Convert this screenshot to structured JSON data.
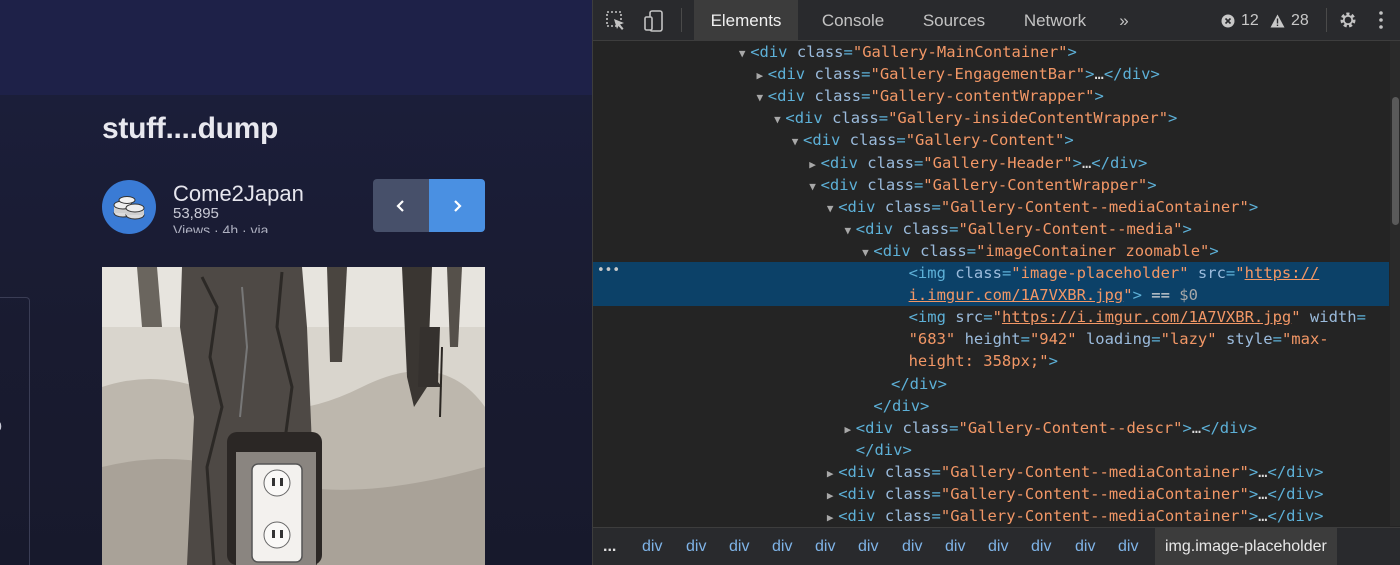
{
  "page": {
    "post_title": "stuff....dump",
    "author_name": "Come2Japan",
    "views": "53,895",
    "meta_line": "Views · 4h · via",
    "side_marks": [
      "-",
      "0",
      "-"
    ]
  },
  "devtools": {
    "tabs": [
      "Elements",
      "Console",
      "Sources",
      "Network",
      "»"
    ],
    "active_tab": "Elements",
    "error_count": "12",
    "warning_count": "28",
    "colors": {
      "selected_row": "#0c4168",
      "tag": "#5db0d7",
      "attr_name": "#9bbbdc",
      "attr_value": "#f29766"
    },
    "dom_lines": [
      {
        "indent": 8,
        "toggle": "open",
        "segments": [
          [
            "tag",
            "<div "
          ],
          [
            "attr",
            "class"
          ],
          [
            "tag",
            "="
          ],
          [
            "val",
            "\"Gallery-MainContainer\""
          ],
          [
            "tag",
            ">"
          ]
        ]
      },
      {
        "indent": 9,
        "toggle": "closed",
        "segments": [
          [
            "tag",
            "<div "
          ],
          [
            "attr",
            "class"
          ],
          [
            "tag",
            "="
          ],
          [
            "val",
            "\"Gallery-EngagementBar\""
          ],
          [
            "tag",
            ">"
          ],
          [
            "plain",
            "…"
          ],
          [
            "tag",
            "</div>"
          ]
        ]
      },
      {
        "indent": 9,
        "toggle": "open",
        "segments": [
          [
            "tag",
            "<div "
          ],
          [
            "attr",
            "class"
          ],
          [
            "tag",
            "="
          ],
          [
            "val",
            "\"Gallery-contentWrapper\""
          ],
          [
            "tag",
            ">"
          ]
        ]
      },
      {
        "indent": 10,
        "toggle": "open",
        "segments": [
          [
            "tag",
            "<div "
          ],
          [
            "attr",
            "class"
          ],
          [
            "tag",
            "="
          ],
          [
            "val",
            "\"Gallery-insideContentWrapper\""
          ],
          [
            "tag",
            ">"
          ]
        ]
      },
      {
        "indent": 11,
        "toggle": "open",
        "segments": [
          [
            "tag",
            "<div "
          ],
          [
            "attr",
            "class"
          ],
          [
            "tag",
            "="
          ],
          [
            "val",
            "\"Gallery-Content\""
          ],
          [
            "tag",
            ">"
          ]
        ]
      },
      {
        "indent": 12,
        "toggle": "closed",
        "segments": [
          [
            "tag",
            "<div "
          ],
          [
            "attr",
            "class"
          ],
          [
            "tag",
            "="
          ],
          [
            "val",
            "\"Gallery-Header\""
          ],
          [
            "tag",
            ">"
          ],
          [
            "plain",
            "…"
          ],
          [
            "tag",
            "</div>"
          ]
        ]
      },
      {
        "indent": 12,
        "toggle": "open",
        "segments": [
          [
            "tag",
            "<div "
          ],
          [
            "attr",
            "class"
          ],
          [
            "tag",
            "="
          ],
          [
            "val",
            "\"Gallery-ContentWrapper\""
          ],
          [
            "tag",
            ">"
          ]
        ]
      },
      {
        "indent": 13,
        "toggle": "open",
        "segments": [
          [
            "tag",
            "<div "
          ],
          [
            "attr",
            "class"
          ],
          [
            "tag",
            "="
          ],
          [
            "val",
            "\"Gallery-Content--mediaContainer\""
          ],
          [
            "tag",
            ">"
          ]
        ]
      },
      {
        "indent": 14,
        "toggle": "open",
        "segments": [
          [
            "tag",
            "<div "
          ],
          [
            "attr",
            "class"
          ],
          [
            "tag",
            "="
          ],
          [
            "val",
            "\"Gallery-Content--media\""
          ],
          [
            "tag",
            ">"
          ]
        ]
      },
      {
        "indent": 15,
        "toggle": "open",
        "segments": [
          [
            "tag",
            "<div "
          ],
          [
            "attr",
            "class"
          ],
          [
            "tag",
            "="
          ],
          [
            "val",
            "\"imageContainer zoomable\""
          ],
          [
            "tag",
            ">"
          ]
        ]
      },
      {
        "indent": 17,
        "toggle": "none",
        "selected": true,
        "segments": [
          [
            "tag",
            "<img "
          ],
          [
            "attr",
            "class"
          ],
          [
            "tag",
            "="
          ],
          [
            "val",
            "\"image-placeholder\""
          ],
          [
            "attr",
            " src"
          ],
          [
            "tag",
            "="
          ],
          [
            "val",
            "\""
          ],
          [
            "link",
            "https://"
          ]
        ]
      },
      {
        "indent": 17,
        "toggle": "none",
        "selected": true,
        "segments": [
          [
            "link",
            "i.imgur.com/1A7VXBR.jpg"
          ],
          [
            "val",
            "\""
          ],
          [
            "tag",
            ">"
          ],
          [
            "plain",
            " == "
          ],
          [
            "dim",
            "$0"
          ]
        ]
      },
      {
        "indent": 17,
        "toggle": "none",
        "segments": [
          [
            "tag",
            "<img "
          ],
          [
            "attr",
            "src"
          ],
          [
            "tag",
            "="
          ],
          [
            "val",
            "\""
          ],
          [
            "link",
            "https://i.imgur.com/1A7VXBR.jpg"
          ],
          [
            "val",
            "\""
          ],
          [
            "attr",
            " width"
          ],
          [
            "tag",
            "="
          ]
        ]
      },
      {
        "indent": 17,
        "toggle": "none",
        "segments": [
          [
            "val",
            "\"683\""
          ],
          [
            "attr",
            " height"
          ],
          [
            "tag",
            "="
          ],
          [
            "val",
            "\"942\""
          ],
          [
            "attr",
            " loading"
          ],
          [
            "tag",
            "="
          ],
          [
            "val",
            "\"lazy\""
          ],
          [
            "attr",
            " style"
          ],
          [
            "tag",
            "="
          ],
          [
            "val",
            "\"max-"
          ]
        ]
      },
      {
        "indent": 17,
        "toggle": "none",
        "segments": [
          [
            "val",
            "height: 358px;\""
          ],
          [
            "tag",
            ">"
          ]
        ]
      },
      {
        "indent": 16,
        "toggle": "none",
        "segments": [
          [
            "tag",
            "</div>"
          ]
        ]
      },
      {
        "indent": 15,
        "toggle": "none",
        "segments": [
          [
            "tag",
            "</div>"
          ]
        ]
      },
      {
        "indent": 14,
        "toggle": "closed",
        "segments": [
          [
            "tag",
            "<div "
          ],
          [
            "attr",
            "class"
          ],
          [
            "tag",
            "="
          ],
          [
            "val",
            "\"Gallery-Content--descr\""
          ],
          [
            "tag",
            ">"
          ],
          [
            "plain",
            "…"
          ],
          [
            "tag",
            "</div>"
          ]
        ]
      },
      {
        "indent": 14,
        "toggle": "none",
        "segments": [
          [
            "tag",
            "</div>"
          ]
        ]
      },
      {
        "indent": 13,
        "toggle": "closed",
        "segments": [
          [
            "tag",
            "<div "
          ],
          [
            "attr",
            "class"
          ],
          [
            "tag",
            "="
          ],
          [
            "val",
            "\"Gallery-Content--mediaContainer\""
          ],
          [
            "tag",
            ">"
          ],
          [
            "plain",
            "…"
          ],
          [
            "tag",
            "</div>"
          ]
        ]
      },
      {
        "indent": 13,
        "toggle": "closed",
        "segments": [
          [
            "tag",
            "<div "
          ],
          [
            "attr",
            "class"
          ],
          [
            "tag",
            "="
          ],
          [
            "val",
            "\"Gallery-Content--mediaContainer\""
          ],
          [
            "tag",
            ">"
          ],
          [
            "plain",
            "…"
          ],
          [
            "tag",
            "</div>"
          ]
        ]
      },
      {
        "indent": 13,
        "toggle": "closed",
        "segments": [
          [
            "tag",
            "<div "
          ],
          [
            "attr",
            "class"
          ],
          [
            "tag",
            "="
          ],
          [
            "val",
            "\"Gallery-Content--mediaContainer\""
          ],
          [
            "tag",
            ">"
          ],
          [
            "plain",
            "…"
          ],
          [
            "tag",
            "</div>"
          ]
        ]
      }
    ],
    "dom_dots": "•••",
    "breadcrumbs": [
      "...",
      "div",
      "div",
      "div",
      "div",
      "div",
      "div",
      "div",
      "div",
      "div",
      "div",
      "div",
      "div",
      "img.image-placeholder"
    ]
  }
}
